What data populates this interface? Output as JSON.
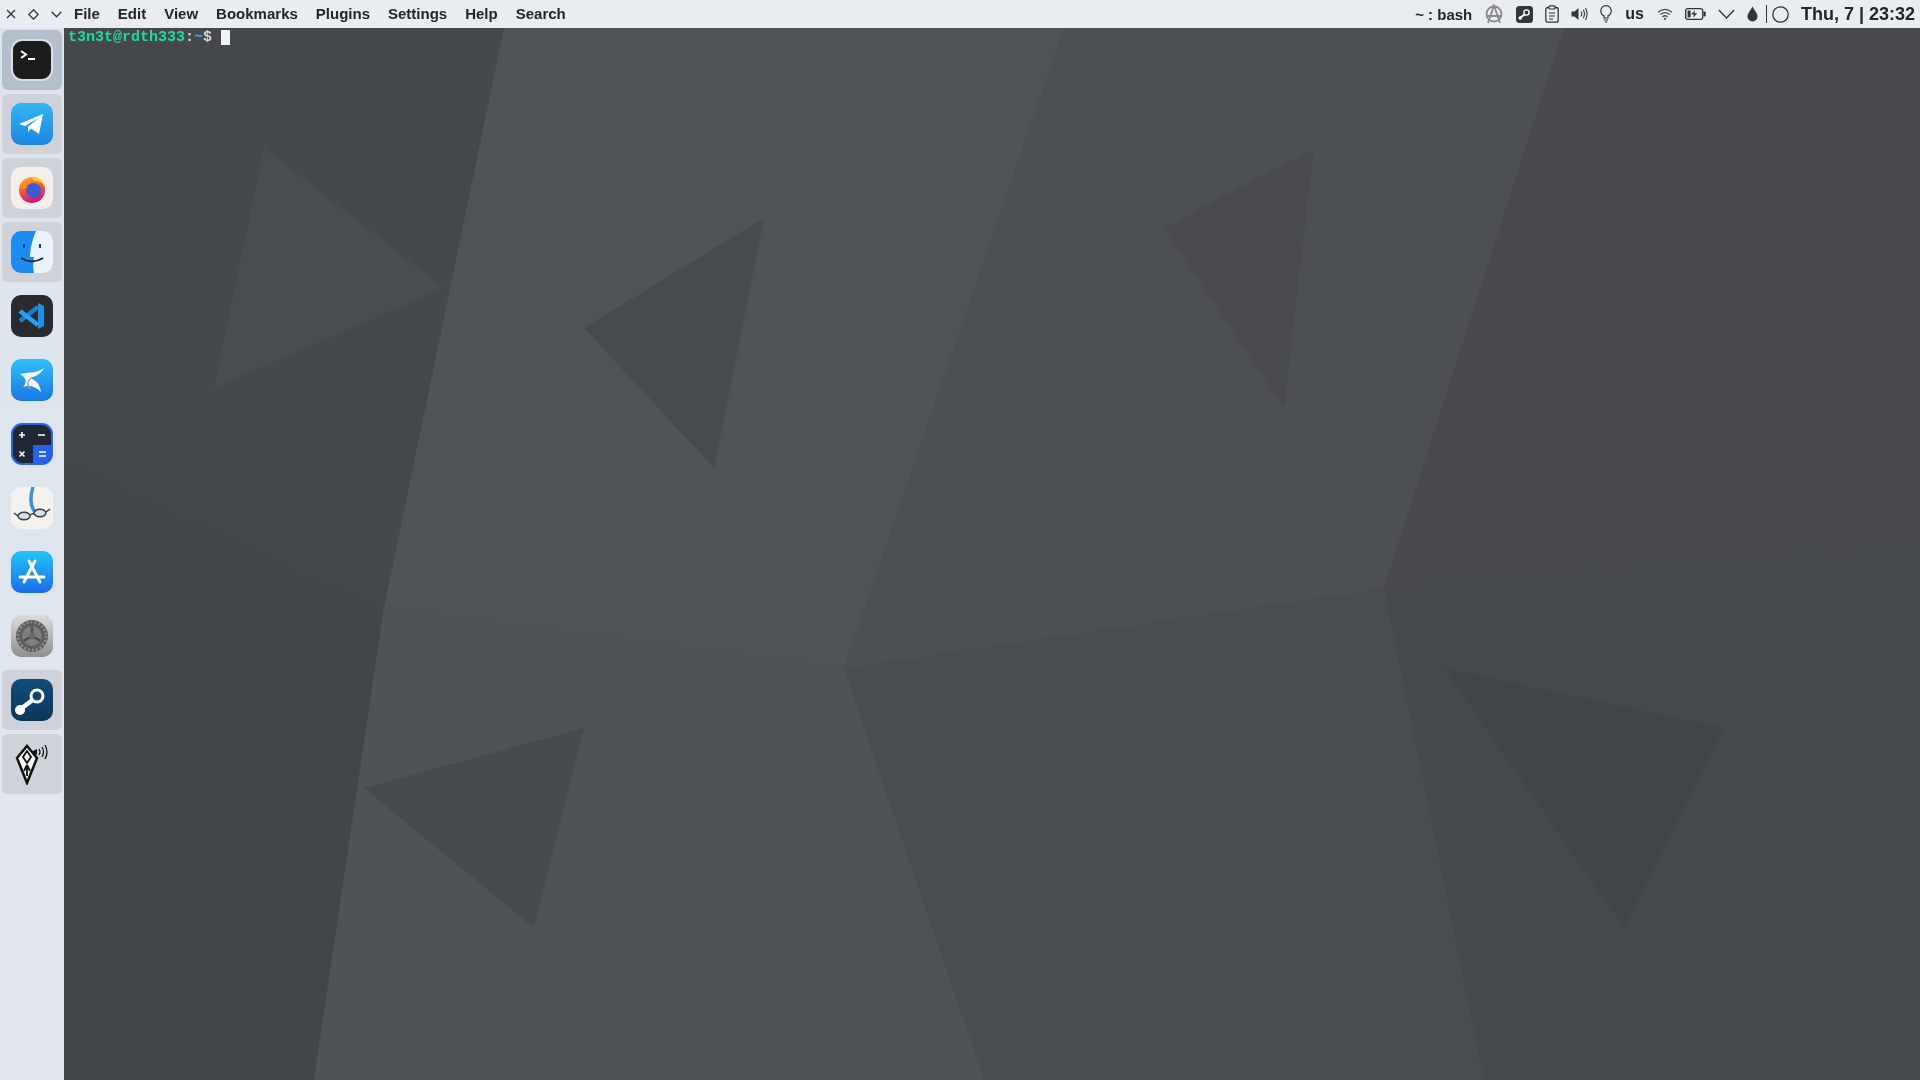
{
  "menu_bar": {
    "menus": [
      "File",
      "Edit",
      "View",
      "Bookmarks",
      "Plugins",
      "Settings",
      "Help",
      "Search"
    ],
    "window_title": "~ : bash",
    "keyboard_layout": "us",
    "clock": "Thu, 7 | 23:32"
  },
  "dock": {
    "items": [
      {
        "kind": "terminal",
        "running": true,
        "selected": true
      },
      {
        "kind": "messenger",
        "running": true,
        "selected": false
      },
      {
        "kind": "browser",
        "running": true,
        "selected": false
      },
      {
        "kind": "file_manager",
        "running": true,
        "selected": false
      },
      {
        "kind": "code_editor",
        "running": false,
        "selected": false
      },
      {
        "kind": "swoosh",
        "running": false,
        "selected": false
      },
      {
        "kind": "calculator",
        "running": false,
        "selected": false
      },
      {
        "kind": "reader",
        "running": false,
        "selected": false
      },
      {
        "kind": "store",
        "running": false,
        "selected": false
      },
      {
        "kind": "settings",
        "running": false,
        "selected": false
      },
      {
        "kind": "game_store",
        "running": true,
        "selected": false
      },
      {
        "kind": "game",
        "running": true,
        "selected": false
      }
    ]
  },
  "terminal": {
    "prompt": {
      "user_host": "t3n3t@rdth333",
      "separator": ":",
      "path": "~",
      "symbol": "$"
    },
    "cursor_shown": true
  }
}
